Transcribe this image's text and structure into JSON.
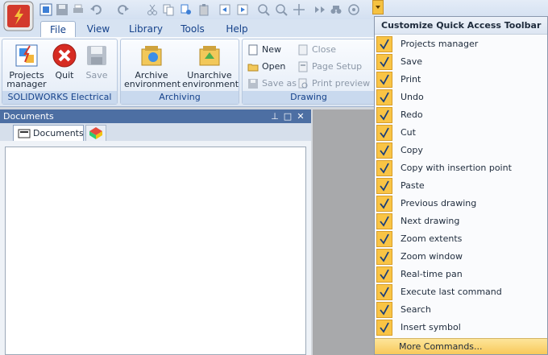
{
  "tabs": [
    {
      "label": "File"
    },
    {
      "label": "View"
    },
    {
      "label": "Library"
    },
    {
      "label": "Tools"
    },
    {
      "label": "Help"
    }
  ],
  "ribbon": {
    "electrical_group": {
      "label": "SOLIDWORKS Electrical",
      "projects_manager": "Projects\nmanager",
      "quit": "Quit",
      "save": "Save"
    },
    "archiving_group": {
      "label": "Archiving",
      "archive": "Archive\nenvironment",
      "unarchive": "Unarchive\nenvironment"
    },
    "drawing_group": {
      "label": "Drawing",
      "new": "New",
      "open": "Open",
      "save_as": "Save as",
      "close": "Close",
      "page_setup": "Page Setup",
      "print_preview": "Print preview"
    }
  },
  "documents_panel": {
    "title": "Documents",
    "tab_documents": "Documents"
  },
  "qat_menu": {
    "title": "Customize Quick Access Toolbar",
    "items": [
      {
        "label": "Projects manager",
        "checked": true
      },
      {
        "label": "Save",
        "checked": true
      },
      {
        "label": "Print",
        "checked": true
      },
      {
        "label": "Undo",
        "checked": true
      },
      {
        "label": "Redo",
        "checked": true
      },
      {
        "label": "Cut",
        "checked": true
      },
      {
        "label": "Copy",
        "checked": true
      },
      {
        "label": "Copy with insertion point",
        "checked": true
      },
      {
        "label": "Paste",
        "checked": true
      },
      {
        "label": "Previous drawing",
        "checked": true
      },
      {
        "label": "Next drawing",
        "checked": true
      },
      {
        "label": "Zoom extents",
        "checked": true
      },
      {
        "label": "Zoom window",
        "checked": true
      },
      {
        "label": "Real-time pan",
        "checked": true
      },
      {
        "label": "Execute last command",
        "checked": true
      },
      {
        "label": "Search",
        "checked": true
      },
      {
        "label": "Insert symbol",
        "checked": true
      }
    ],
    "more": "More Commands..."
  },
  "colors": {
    "accent": "#15428b",
    "highlight": "#f9c445"
  }
}
